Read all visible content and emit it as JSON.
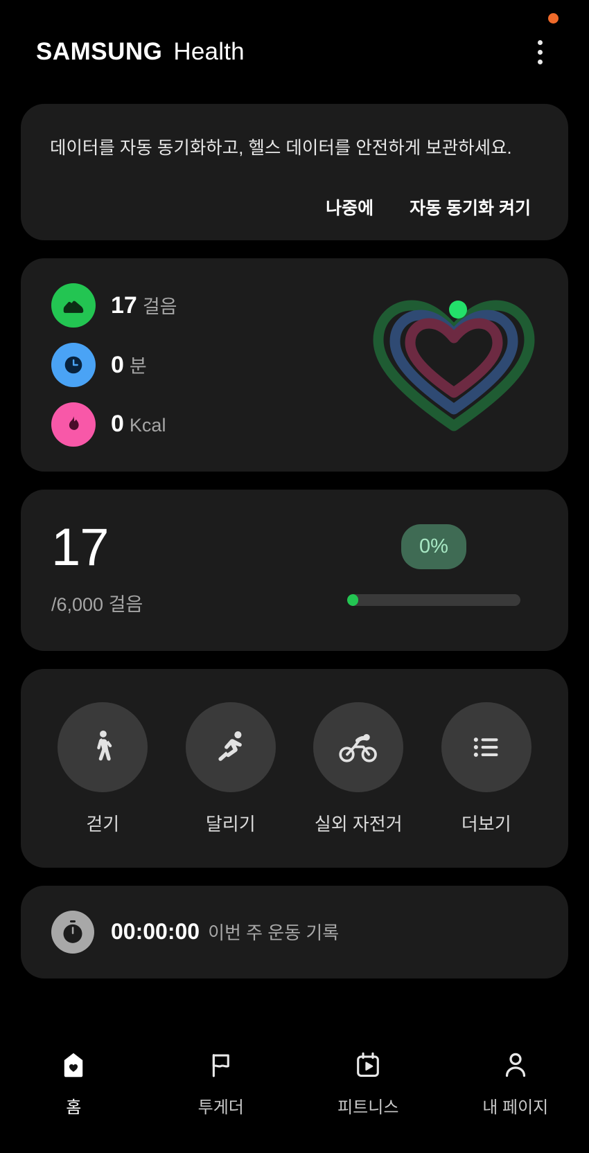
{
  "header": {
    "brand_samsung": "SAMSUNG",
    "brand_health": "Health",
    "menu_icon": "more-vertical-icon",
    "notification_dot_color": "#ef6a2a"
  },
  "sync_banner": {
    "message": "데이터를 자동 동기화하고, 헬스 데이터를 안전하게 보관하세요.",
    "later_label": "나중에",
    "enable_label": "자동 동기화 켜기"
  },
  "activity": {
    "metrics": [
      {
        "icon": "shoe-icon",
        "value": "17",
        "unit": "걸음",
        "color": "#23c552"
      },
      {
        "icon": "clock-icon",
        "value": "0",
        "unit": "분",
        "color": "#4aa3f5"
      },
      {
        "icon": "flame-icon",
        "value": "0",
        "unit": "Kcal",
        "color": "#f858a8"
      }
    ],
    "rings": {
      "outer_color": "#1f5c33",
      "middle_color": "#2f4a73",
      "inner_color": "#6d2a42",
      "marker_color": "#23e06a"
    }
  },
  "steps": {
    "count": "17",
    "goal_text": "/6,000 걸음",
    "percent": "0%",
    "percent_bg": "#3f6b54",
    "percent_fg": "#a8e8c4",
    "progress_value": 2,
    "bar_color": "#23c552"
  },
  "shortcuts": [
    {
      "icon": "walking-icon",
      "label": "걷기"
    },
    {
      "icon": "running-icon",
      "label": "달리기"
    },
    {
      "icon": "cycling-icon",
      "label": "실외 자전거"
    },
    {
      "icon": "list-icon",
      "label": "더보기"
    }
  ],
  "timer": {
    "icon": "stopwatch-icon",
    "value": "00:00:00",
    "label": "이번 주 운동 기록"
  },
  "bottom_nav": [
    {
      "icon": "home-heart-icon",
      "label": "홈",
      "active": true
    },
    {
      "icon": "flag-icon",
      "label": "투게더",
      "active": false
    },
    {
      "icon": "fitness-calendar-icon",
      "label": "피트니스",
      "active": false
    },
    {
      "icon": "person-icon",
      "label": "내 페이지",
      "active": false
    }
  ]
}
